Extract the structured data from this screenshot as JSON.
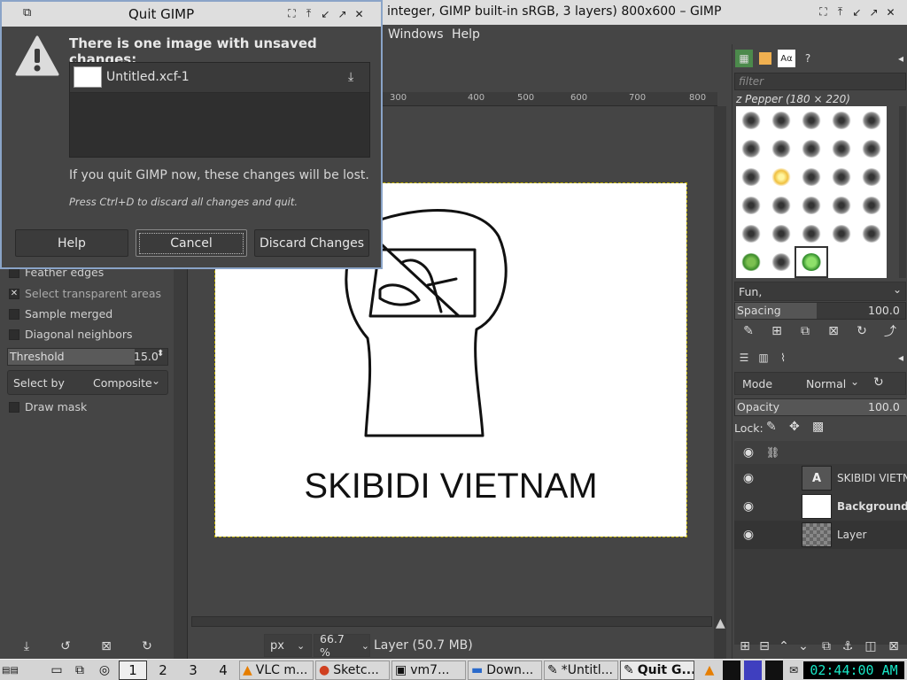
{
  "main_window": {
    "title": "integer, GIMP built-in sRGB, 3 layers) 800x600 – GIMP",
    "menu": [
      "Windows",
      "Help"
    ],
    "controls": [
      "restore-icon",
      "pin-icon",
      "minimize-icon",
      "maximize-icon",
      "close-icon"
    ]
  },
  "quit_dialog": {
    "title": "Quit GIMP",
    "heading": "There is one image with unsaved changes:",
    "item_name": "Untitled.xcf-1",
    "message": "If you quit GIMP now, these changes will be lost.",
    "hint": "Press Ctrl+D to discard all changes and quit.",
    "buttons": {
      "help": "Help",
      "cancel": "Cancel",
      "discard": "Discard Changes"
    }
  },
  "tool_options": {
    "feather_edges": {
      "label": "Feather edges",
      "checked": false
    },
    "select_transparent": {
      "label": "Select transparent areas",
      "checked": true
    },
    "sample_merged": {
      "label": "Sample merged",
      "checked": false
    },
    "diagonal_neighbors": {
      "label": "Diagonal neighbors",
      "checked": false
    },
    "threshold": {
      "label": "Threshold",
      "value": "15.0"
    },
    "select_by": {
      "label": "Select by",
      "value": "Composite"
    },
    "draw_mask": {
      "label": "Draw mask",
      "checked": false
    }
  },
  "canvas": {
    "ruler_labels": [
      "300",
      "400",
      "500",
      "600",
      "700",
      "800"
    ],
    "caption": "SKIBIDI VIETNAM"
  },
  "status": {
    "unit": "px",
    "zoom": "66.7 %",
    "layer_info": "Layer (50.7 MB)"
  },
  "brushes": {
    "filter_placeholder": "filter",
    "current": "z Pepper (180 × 220)",
    "tag": "Fun,",
    "spacing_label": "Spacing",
    "spacing_value": "100.0"
  },
  "layers": {
    "mode_label": "Mode",
    "mode_value": "Normal",
    "opacity_label": "Opacity",
    "opacity_value": "100.0",
    "lock_label": "Lock:",
    "items": [
      {
        "name": "SKIBIDI VIETNA",
        "type": "text"
      },
      {
        "name": "Background",
        "type": "image"
      },
      {
        "name": "Layer",
        "type": "transparent"
      }
    ]
  },
  "taskbar": {
    "workspaces": [
      "1",
      "2",
      "3",
      "4"
    ],
    "tasks": [
      "VLC m...",
      "Sketc...",
      "vm7...",
      "Down...",
      "*Untitl...",
      "Quit G..."
    ],
    "active_task": "Quit G...",
    "clock": "02:44:00 AM"
  }
}
